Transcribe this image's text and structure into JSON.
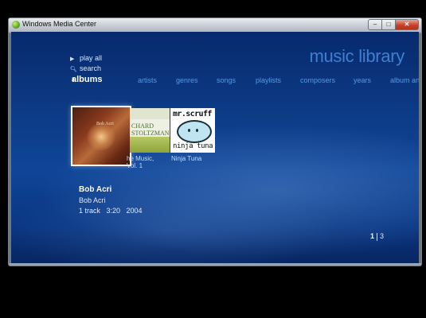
{
  "window": {
    "title": "Windows Media Center",
    "buttons": {
      "minimize": "–",
      "maximize": "□",
      "close": "✕"
    }
  },
  "section_title": "music library",
  "commands": [
    {
      "label": "play all",
      "icon": "play-icon"
    },
    {
      "label": "search",
      "icon": "search-icon"
    }
  ],
  "filters": {
    "active": "albums",
    "items": [
      "artists",
      "genres",
      "songs",
      "playlists",
      "composers",
      "years",
      "album artis"
    ]
  },
  "albums": [
    {
      "art_text": "Bob Acri",
      "caption": "",
      "selected": true
    },
    {
      "art_text": "CHARD\nSTOLTZMAN",
      "caption": "he Music,\nVol. 1",
      "selected": false
    },
    {
      "art_text": "mr.scruff",
      "art_text2": "ninja tuna",
      "caption": "Ninja Tuna",
      "selected": false
    }
  ],
  "details": {
    "title": "Bob Acri",
    "artist": "Bob Acri",
    "meta": "1 track   3:20   2004"
  },
  "pager": {
    "current": "1",
    "total": "3"
  },
  "colors": {
    "background": "#0d3b86",
    "section_title": "#3f7fd0",
    "filter_text": "#4f9be8"
  }
}
